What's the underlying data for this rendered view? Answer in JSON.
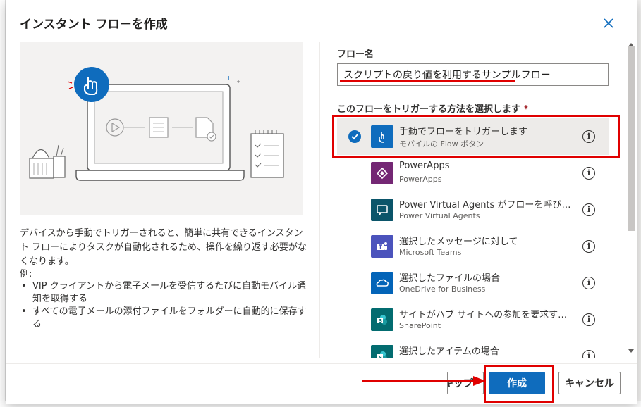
{
  "dialog": {
    "title": "インスタント フローを作成",
    "description": "デバイスから手動でトリガーされると、簡単に共有できるインスタント フローによりタスクが自動化されるため、操作を繰り返す必要がなくなります。",
    "examples_label": "例:",
    "examples": [
      "VIP クライアントから電子メールを受信するたびに自動モバイル通知を取得する",
      "すべての電子メールの添付ファイルをフォルダーに自動的に保存する"
    ]
  },
  "form": {
    "flow_name_label": "フロー名",
    "flow_name_value": "スクリプトの戻り値を利用するサンプルフロー",
    "trigger_label": "このフローをトリガーする方法を選択します",
    "required_mark": "*"
  },
  "triggers": [
    {
      "title": "手動でフローをトリガーします",
      "subtitle": "モバイルの Flow ボタン",
      "icon": "touch-icon",
      "color": "#0f6cbd",
      "selected": true
    },
    {
      "title": "PowerApps",
      "subtitle": "PowerApps",
      "icon": "powerapps-icon",
      "color": "#742774",
      "selected": false
    },
    {
      "title": "Power Virtual Agents がフローを呼び出...",
      "subtitle": "Power Virtual Agents",
      "icon": "chat-icon",
      "color": "#0b556a",
      "selected": false
    },
    {
      "title": "選択したメッセージに対して",
      "subtitle": "Microsoft Teams",
      "icon": "teams-icon",
      "color": "#4b53bc",
      "selected": false
    },
    {
      "title": "選択したファイルの場合",
      "subtitle": "OneDrive for Business",
      "icon": "onedrive-icon",
      "color": "#0364b8",
      "selected": false
    },
    {
      "title": "サイトがハブ サイトへの参加を要求するとき",
      "subtitle": "SharePoint",
      "icon": "sharepoint-icon",
      "color": "#036c70",
      "selected": false
    },
    {
      "title": "選択したアイテムの場合",
      "subtitle": "",
      "icon": "sharepoint-icon",
      "color": "#036c70",
      "selected": false
    }
  ],
  "buttons": {
    "skip": "スキップ",
    "create": "作成",
    "cancel": "キャンセル"
  }
}
